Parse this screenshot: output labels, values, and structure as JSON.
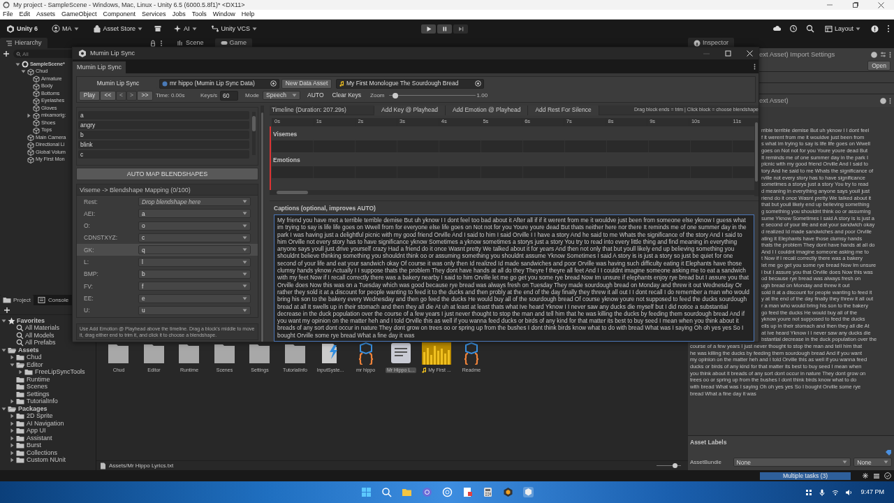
{
  "window": {
    "title": "My project - SampleScene - Windows, Mac, Linux - Unity 6.5 (6000.5.8f1)* <DX11>"
  },
  "menu": [
    "File",
    "Edit",
    "Assets",
    "GameObject",
    "Component",
    "Services",
    "Jobs",
    "Tools",
    "Window",
    "Help"
  ],
  "toolbar": {
    "items": [
      {
        "label": "Unity 6",
        "kind": "logo"
      },
      {
        "label": "MA",
        "kind": "account"
      },
      {
        "label": "Asset Store",
        "kind": "store"
      },
      {
        "label": "AI",
        "kind": "ai"
      },
      {
        "label": "Unity VCS",
        "kind": "vcs"
      }
    ],
    "layout": "Layout"
  },
  "hierarchy": {
    "tab": "Hierarchy",
    "search_placeholder": "All",
    "tree": [
      {
        "label": "SampleScene*",
        "kind": "scene",
        "expanded": true,
        "children": [
          {
            "label": "Chud",
            "kind": "object",
            "expanded": true,
            "children": [
              {
                "label": "Armature",
                "kind": "object"
              },
              {
                "label": "Body",
                "kind": "object"
              },
              {
                "label": "Bottoms",
                "kind": "object"
              },
              {
                "label": "Eyelashes",
                "kind": "object"
              },
              {
                "label": "Gloves",
                "kind": "object"
              },
              {
                "label": "mixamorig:",
                "kind": "object",
                "expanded": false
              },
              {
                "label": "Shoes",
                "kind": "object"
              },
              {
                "label": "Tops",
                "kind": "object"
              }
            ]
          },
          {
            "label": "Main Camera",
            "kind": "object"
          },
          {
            "label": "Directional Li",
            "kind": "object"
          },
          {
            "label": "Global Volum",
            "kind": "object"
          },
          {
            "label": "My First Mon",
            "kind": "object"
          }
        ]
      }
    ]
  },
  "scene_tabs": [
    {
      "label": "Scene",
      "selected": false
    },
    {
      "label": "Game",
      "selected": true
    }
  ],
  "lipsync": {
    "title": "Mumin Lip Sync",
    "tab": "Mumin Lip Sync",
    "header_label": "Mumin Lip Sync",
    "data_field": "mr hippo (Mumin Lip Sync Data)",
    "new_button": "New Data Asset",
    "audio_field": "My First Monologue The Sourdough Bread",
    "transport": [
      {
        "label": "Play",
        "disabled": false
      },
      {
        "label": "<<",
        "disabled": false
      },
      {
        "label": "<",
        "disabled": true
      },
      {
        "label": ">",
        "disabled": true
      },
      {
        "label": ">>",
        "disabled": false
      }
    ],
    "time": "Time: 0.00s",
    "keys_label": "Keys/s",
    "keys_value": "60",
    "mode_label": "Mode",
    "mode_value": "Speech",
    "auto_button": "AUTO",
    "clear_button": "Clear Keys",
    "zoom_label": "Zoom",
    "zoom": {
      "level": 0.08
    },
    "zoom_value": "1.00",
    "blendshapes": [
      "a",
      "angry",
      "b",
      "blink",
      "c"
    ],
    "auto_map_button": "AUTO MAP BLENDSHAPES",
    "mapping": {
      "title": "Viseme -> Blendshape Mapping (0/100)",
      "rows": [
        {
          "label": "Rest:",
          "placeholder": "Drop blendshape here",
          "selected": false
        },
        {
          "label": "AEI:",
          "value": "a",
          "selected": false
        },
        {
          "label": "O:",
          "value": "o",
          "selected": false
        },
        {
          "label": "CDNSTXYZ:",
          "value": "c",
          "selected": false
        },
        {
          "label": "GK:",
          "value": "q",
          "selected": true
        },
        {
          "label": "L:",
          "value": "l",
          "selected": false
        },
        {
          "label": "BMP:",
          "value": "b",
          "selected": false
        },
        {
          "label": "FV:",
          "value": "f",
          "selected": false
        },
        {
          "label": "EE:",
          "value": "e",
          "selected": false
        },
        {
          "label": "U:",
          "value": "u",
          "selected": false
        }
      ]
    },
    "help": "Use Add Emotion @ Playhead above the timeline. Drag a block's middle to move it, drag either end to trim it, and click it to choose a blendshape.",
    "timeline": {
      "title": "Timeline (Duration: 207.29s)",
      "buttons": [
        "Add Key @ Playhead",
        "Add Emotion @ Playhead",
        "Add Rest For Silence"
      ],
      "hint": "Drag block ends = trim | Click block = choose blendshape",
      "ticks": [
        "0s",
        "1s",
        "2s",
        "3s",
        "4s",
        "5s",
        "6s",
        "7s",
        "8s",
        "9s",
        "10s",
        "11s"
      ],
      "tracks": [
        "Visemes",
        "Emotions"
      ]
    },
    "captions": {
      "label": "Captions (optional, improves AUTO)",
      "value": "My friend you have met a terrible terrible demise But uh yknow I I dont feel too bad about it After all if if it werent from me it wouldve just been from someone else yknow I guess what im trying to say is life life goes on Wwell from for everyone else life goes on Not not for you Youre youre dead But thats neither here nor there It reminds me of one summer day in the park I was having just a delightful picnic with my good friend Orville And I said to him I said Orville I I have a story And he said to me Whats the significance of the story And I said to him Orville not every story has to have significance yknow Sometimes a yknow sometimes a storys just a story You try to read into every little thing and find meaning in everything anyone says youll just drive yourself crazy Had a friend do it once Wasnt pretty We talked about it for years And then not only that but youll likely end up believing something you shouldnt believe thinking something you shouldnt think oo or assuming something you shouldnt assume Yknow Sometimes I said A story is is just a story so just be quiet for one second of your life and eat your sandwich okay Of course it was only then Id realized Id made sandwiches and poor Orville was having such difficulty eating it Elephants have those clumsy hands yknow Actually I I suppose thats the problem They dont have hands at all do they Theyre f theyre all feet And I I couldnt imagine someone asking me to eat a sandwich with my feet Now if I recall correctly there was a bakery nearby I said to him Orville let me go get you some rye bread Now Im unsure if elephants enjoy rye bread but I assure you that Orville does Now this was on a Tuesday which was good because rye bread was always fresh on Tuesday They made sourdough bread on Monday and threw it out Wednesday Or rather they sold it at a discount for people wanting to feed it to the ducks and then probly at the end of the day finally they threw it all out I I dont recall I do remember a man who would bring his son to the bakery every Wednesday and then go feed the ducks He would buy all of the sourdough bread Of course yknow youre not supposed to feed the ducks sourdough bread at all It swells up in their stomach and then they all die At uh at least at least thats what Ive heard Yknow I I never saw any ducks die myself but I did notice a substantial decrease in the duck population over the course of a few years I just never thought to stop the man and tell him that he was killing the ducks by feeding them sourdough bread And if you want my opinion on the matter heh and I told Orville this as well if you wanna feed ducks or birds of any kind for that matter its best to buy seed I mean when you think about it breads of any sort dont occur in nature They dont grow on trees oo or spring up from the bushes I dont think birds know what to do with bread What was I saying Oh oh yes yes So I bought Orville some rye bread What a fine day it was"
    }
  },
  "inspector": {
    "tab": "Inspector",
    "header": "ext Asset) Import Settings",
    "open_button": "Open",
    "section": "ext Asset)",
    "covered_lines": [
      "rrible terrible demise But uh yknow I I dont feel",
      "f it werent from me it wouldve just been from",
      "s what im trying to say is life life goes on Wwell",
      "goes on Not not for you Youre youre dead But",
      "It reminds me of one summer day in the park I",
      "picnic with my good friend Orville And I said to",
      "tory And he said to me Whats the significance of",
      "rville not every story has to have significance",
      "sometimes a storys just a story You try to read",
      "d meaning in everything anyone says youll just",
      "riend do it once Wasnt pretty We talked about it",
      "that but youll likely end up believing something",
      "g something you shouldnt think oo or assuming",
      "sume Yknow Sometimes I said A story is is just a",
      "e second of your life and eat your sandwich okay",
      "d realized Id made sandwiches and poor Orville",
      "ating it Elephants have those clumsy hands",
      "thats the problem They dont have hands at all do",
      "And I I couldnt imagine someone asking me to",
      "t Now if I recall correctly there was a bakery",
      "let me go get you some rye bread Now Im unsure",
      "l but I assure you that Orville does Now this was",
      "od because rye bread was always fresh on",
      "ugh bread on Monday and threw it out",
      "sold it at a discount for people wanting to feed it",
      "y at the end of the day finally they threw it all out",
      "r a man who would bring his son to the bakery",
      "go feed the ducks He would buy all of the",
      "yknow youre not supposed to feed the ducks",
      "ells up in their stomach and then they all die At",
      "at Ive heard Yknow I I never saw any ducks die",
      "bstantial decrease in the duck population over the"
    ],
    "lines": [
      "course of a few years I just never thought to stop the man and tell him that",
      "he was killing the ducks by feeding them sourdough bread And if you want",
      "my opinion on the matter heh and I told Orville this as well if you wanna feed",
      "ducks or birds of any kind for that matter its best to buy seed I mean when",
      "you think about it breads of any sort dont occur in nature They dont grow on",
      "trees oo or spring up from the bushes I dont think birds know what to do",
      "with bread What was I saying Oh oh yes yes So I bought Orville some rye",
      "bread What a fine day it was"
    ],
    "labels_title": "Asset Labels",
    "bundle_label": "AssetBundle",
    "bundle_value": "None",
    "variant_value": "None"
  },
  "project": {
    "tabs": [
      {
        "label": "Project",
        "selected": true
      },
      {
        "label": "Console",
        "selected": false
      }
    ],
    "tree": [
      {
        "label": "Favorites",
        "kind": "favorites",
        "expanded": true,
        "children": [
          {
            "label": "All Materials",
            "kind": "search"
          },
          {
            "label": "All Models",
            "kind": "search"
          },
          {
            "label": "All Prefabs",
            "kind": "search"
          }
        ]
      },
      {
        "label": "Assets",
        "kind": "folder",
        "expanded": true,
        "children": [
          {
            "label": "Chud",
            "kind": "folder",
            "expanded": false
          },
          {
            "label": "Editor",
            "kind": "folder",
            "expanded": true,
            "children": [
              {
                "label": "FreeLipSyncTools",
                "kind": "folder",
                "expanded": false
              }
            ]
          },
          {
            "label": "Runtime",
            "kind": "folder"
          },
          {
            "label": "Scenes",
            "kind": "folder"
          },
          {
            "label": "Settings",
            "kind": "folder"
          },
          {
            "label": "TutorialInfo",
            "kind": "folder",
            "expanded": false
          }
        ]
      },
      {
        "label": "Packages",
        "kind": "folder",
        "expanded": true,
        "children": [
          {
            "label": "2D Sprite",
            "kind": "folder",
            "expanded": false
          },
          {
            "label": "AI Navigation",
            "kind": "folder",
            "expanded": false
          },
          {
            "label": "App UI",
            "kind": "folder",
            "expanded": false
          },
          {
            "label": "Assistant",
            "kind": "folder",
            "expanded": false
          },
          {
            "label": "Burst",
            "kind": "folder",
            "expanded": false
          },
          {
            "label": "Collections",
            "kind": "folder",
            "expanded": false
          },
          {
            "label": "Custom NUnit",
            "kind": "folder",
            "expanded": false
          }
        ]
      }
    ],
    "assets": [
      {
        "label": "Chud",
        "kind": "folder",
        "selected": false
      },
      {
        "label": "Editor",
        "kind": "folder",
        "selected": false
      },
      {
        "label": "Runtime",
        "kind": "folder",
        "selected": false
      },
      {
        "label": "Scenes",
        "kind": "folder",
        "selected": false
      },
      {
        "label": "Settings",
        "kind": "folder",
        "selected": false
      },
      {
        "label": "TutorialInfo",
        "kind": "folder",
        "selected": false
      },
      {
        "label": "InputSyste...",
        "kind": "input",
        "selected": false
      },
      {
        "label": "mr hippo",
        "kind": "script",
        "selected": false
      },
      {
        "label": "Mr Hippo L...",
        "kind": "text",
        "selected": true
      },
      {
        "label": "My First ...",
        "kind": "audio",
        "selected": false
      },
      {
        "label": "Readme",
        "kind": "script",
        "selected": false
      }
    ],
    "path": "Assets/Mr Hippo Lyrics.txt",
    "size_slider": {
      "level": 0.75
    }
  },
  "status": {
    "tasks": "Multiple tasks (3)",
    "level": 1
  },
  "taskbar": {
    "time": "9:47 PM"
  }
}
